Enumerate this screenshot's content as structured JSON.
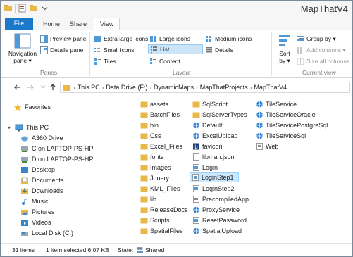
{
  "window": {
    "title": "MapThatV4"
  },
  "qat": {
    "icons": [
      "folder-icon",
      "properties-icon",
      "new-folder-icon",
      "dropdown-icon"
    ]
  },
  "tabs": {
    "file": "File",
    "home": "Home",
    "share": "Share",
    "view": "View"
  },
  "ribbon": {
    "panes": {
      "label": "Panes",
      "navigation_pane_line1": "Navigation",
      "navigation_pane_line2": "pane ▾",
      "preview_pane": "Preview pane",
      "details_pane": "Details pane"
    },
    "layout": {
      "label": "Layout",
      "extra_large_icons": "Extra large icons",
      "large_icons": "Large icons",
      "medium_icons": "Medium icons",
      "small_icons": "Small icons",
      "list": "List",
      "details": "Details",
      "tiles": "Tiles",
      "content": "Content"
    },
    "current_view": {
      "label": "Current view",
      "sort_line1": "Sort",
      "sort_line2": "by ▾",
      "group_by": "Group by ▾",
      "add_columns": "Add columns ▾",
      "size_all_columns": "Size all columns"
    }
  },
  "address": {
    "crumbs": [
      "This PC",
      "Data Drive (F:)",
      "DynamicMaps",
      "MapThatProjects",
      "MapThatV4"
    ]
  },
  "nav": {
    "favorites": "Favorites",
    "this_pc": "This PC",
    "items": [
      "A360 Drive",
      "C on LAPTOP-PS-HP",
      "D on LAPTOP-PS-HP",
      "Desktop",
      "Documents",
      "Downloads",
      "Music",
      "Pictures",
      "Videos",
      "Local Disk (C:)"
    ]
  },
  "files": {
    "col1": [
      "assets",
      "BatchFiles",
      "bin",
      "Css",
      "Excel_Files",
      "fonts",
      "Images",
      "Jquery",
      "KML_Files",
      "lib",
      "ReleaseDocs",
      "Scripts",
      "SpatialFiles"
    ],
    "col2": [
      "SqlScript",
      "SqlServerTypes",
      "Default",
      "ExcelUpload",
      "favicon",
      "libman.json",
      "Login",
      "LoginStep1",
      "LoginStep2",
      "PrecompiledApp",
      "ProxyService",
      "ResetPassword",
      "SpatialUpload"
    ],
    "col3": [
      "TileService",
      "TileServiceOracle",
      "TileServicePostgreSql",
      "TileServiceSql",
      "Web"
    ],
    "selected": "LoginStep1"
  },
  "status": {
    "count": "31 items",
    "selection": "1 item selected  6.07 KB",
    "state_label": "State:",
    "state_value": "Shared"
  },
  "colors": {
    "accent": "#1979ca",
    "selection": "#cce8ff",
    "folder": "#e8b84a"
  }
}
